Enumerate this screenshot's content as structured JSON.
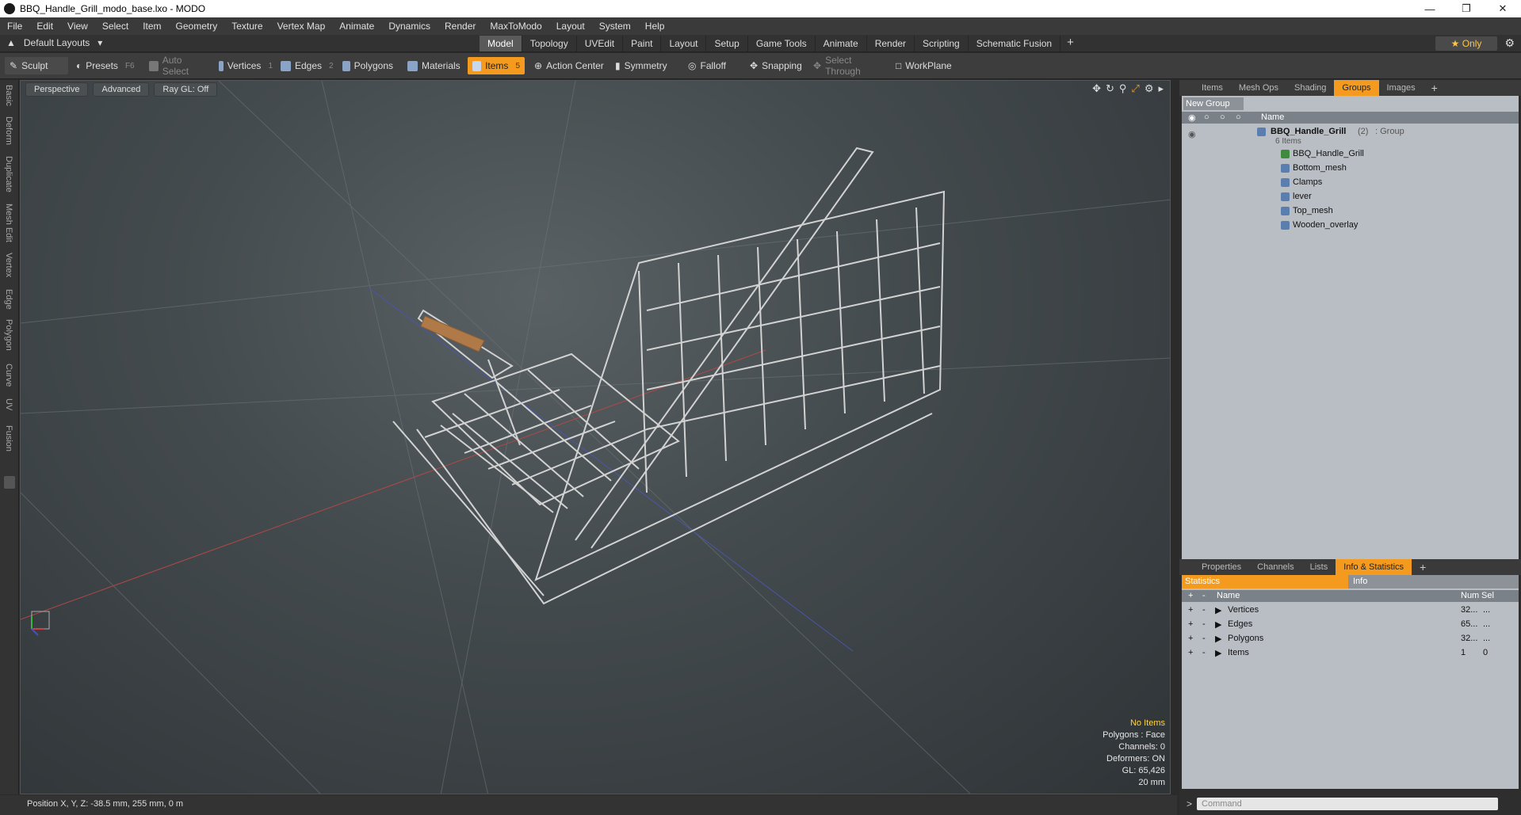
{
  "window": {
    "title": "BBQ_Handle_Grill_modo_base.lxo - MODO"
  },
  "menu": [
    "File",
    "Edit",
    "View",
    "Select",
    "Item",
    "Geometry",
    "Texture",
    "Vertex Map",
    "Animate",
    "Dynamics",
    "Render",
    "MaxToModo",
    "Layout",
    "System",
    "Help"
  ],
  "layout": {
    "selector": "Default Layouts",
    "tabs": [
      "Model",
      "Topology",
      "UVEdit",
      "Paint",
      "Layout",
      "Setup",
      "Game Tools",
      "Animate",
      "Render",
      "Scripting",
      "Schematic Fusion"
    ],
    "active_tab": "Model",
    "only_label": "Only"
  },
  "toolbar": {
    "sculpt": "Sculpt",
    "presets": "Presets",
    "presets_key": "F6",
    "auto_select": "Auto Select",
    "vertices": "Vertices",
    "vertices_key": "1",
    "edges": "Edges",
    "edges_key": "2",
    "polygons": "Polygons",
    "materials": "Materials",
    "items": "Items",
    "items_key": "5",
    "action_center": "Action Center",
    "symmetry": "Symmetry",
    "falloff": "Falloff",
    "snapping": "Snapping",
    "select_through": "Select Through",
    "workplane": "WorkPlane"
  },
  "left_strip": [
    "Basic",
    "Deform",
    "Duplicate",
    "Mesh Edit",
    "Vertex",
    "Edge",
    "Polygon",
    "Curve",
    "UV",
    "Fusion"
  ],
  "viewport": {
    "view": "Perspective",
    "shading": "Advanced",
    "raygl": "Ray GL: Off",
    "info": {
      "no_items": "No Items",
      "polygons": "Polygons : Face",
      "channels": "Channels: 0",
      "deformers": "Deformers: ON",
      "gl": "GL: 65,426",
      "scale": "20 mm"
    }
  },
  "status": {
    "position": "Position X, Y, Z:   -38.5 mm, 255 mm, 0 m"
  },
  "groups_panel": {
    "tabs": [
      "Items",
      "Mesh Ops",
      "Shading",
      "Groups",
      "Images"
    ],
    "active_tab": "Groups",
    "new_group": "New Group",
    "name_col": "Name",
    "group": {
      "name": "BBQ_Handle_Grill",
      "count": "(2)",
      "type": ": Group",
      "items_count": "6 Items"
    },
    "children": [
      "BBQ_Handle_Grill",
      "Bottom_mesh",
      "Clamps",
      "lever",
      "Top_mesh",
      "Wooden_overlay"
    ]
  },
  "info_panel": {
    "tabs": [
      "Properties",
      "Channels",
      "Lists",
      "Info & Statistics"
    ],
    "active_tab": "Info & Statistics",
    "stat_tab": "Statistics",
    "info_tab": "Info",
    "columns": {
      "name": "Name",
      "num": "Num",
      "sel": "Sel"
    },
    "rows": [
      {
        "name": "Vertices",
        "num": "32...",
        "sel": "..."
      },
      {
        "name": "Edges",
        "num": "65...",
        "sel": "..."
      },
      {
        "name": "Polygons",
        "num": "32...",
        "sel": "..."
      },
      {
        "name": "Items",
        "num": "1",
        "sel": "0"
      }
    ]
  },
  "command": {
    "placeholder": "Command"
  }
}
